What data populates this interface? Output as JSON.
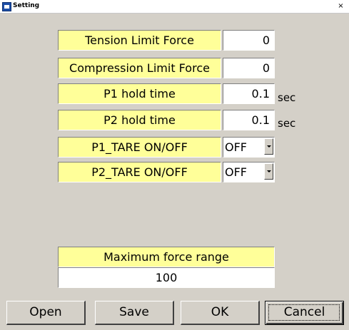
{
  "window": {
    "title": "Setting",
    "close_label": "×"
  },
  "settings": {
    "tension": {
      "label": "Tension Limit Force",
      "value": "0"
    },
    "compression": {
      "label": "Compression Limit Force",
      "value": "0"
    },
    "p1_hold": {
      "label": "P1 hold time",
      "value": "0.1",
      "unit": "sec"
    },
    "p2_hold": {
      "label": "P2 hold time",
      "value": "0.1",
      "unit": "sec"
    },
    "p1_tare": {
      "label": "P1_TARE ON/OFF",
      "selected": "OFF"
    },
    "p2_tare": {
      "label": "P2_TARE ON/OFF",
      "selected": "OFF"
    }
  },
  "max_force": {
    "label": "Maximum force range",
    "value": "100"
  },
  "buttons": {
    "open": "Open",
    "save": "Save",
    "ok": "OK",
    "cancel": "Cancel"
  },
  "colors": {
    "label_bg": "#ffff99",
    "window_bg": "#d4d0c8"
  },
  "icons": {
    "window": "app-icon",
    "close": "close-icon",
    "dropdown": "dropdown-arrow-icon"
  }
}
